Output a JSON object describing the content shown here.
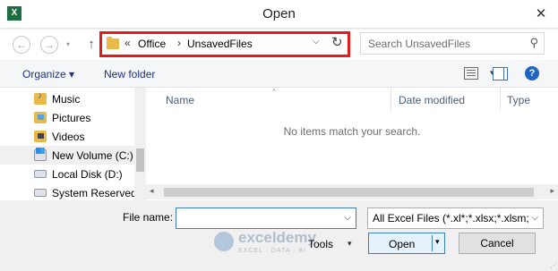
{
  "window": {
    "title": "Open",
    "app_icon": "excel-icon",
    "app_icon_letter": "X",
    "close_symbol": "✕"
  },
  "nav": {
    "back_symbol": "←",
    "forward_symbol": "→",
    "recent_symbol": "▾",
    "up_symbol": "↑"
  },
  "address": {
    "overflow": "«",
    "sep": "›",
    "crumbs": [
      "Office",
      "UnsavedFiles"
    ],
    "dropdown_symbol": "⌵",
    "refresh_symbol": "↻",
    "highlight_color": "#e21b1b"
  },
  "search": {
    "placeholder": "Search UnsavedFiles",
    "icon_symbol": "⚲"
  },
  "toolbar": {
    "organize": "Organize ▾",
    "new_folder": "New folder",
    "view_drop": "▾",
    "help": "?"
  },
  "sidebar": {
    "items": [
      {
        "label": "Music",
        "icon": "music-folder-icon"
      },
      {
        "label": "Pictures",
        "icon": "pictures-folder-icon"
      },
      {
        "label": "Videos",
        "icon": "videos-folder-icon"
      },
      {
        "label": "New Volume (C:)",
        "icon": "windows-drive-icon"
      },
      {
        "label": "Local Disk (D:)",
        "icon": "drive-icon"
      },
      {
        "label": "System Reserved",
        "icon": "drive-icon"
      }
    ]
  },
  "filelist": {
    "columns": [
      "Name",
      "Date modified",
      "Type"
    ],
    "sort_caret": "^",
    "empty_message": "No items match your search.",
    "scroll_left": "◂",
    "scroll_right": "▸"
  },
  "footer": {
    "file_name_label": "File name:",
    "file_name_value": "",
    "file_name_drop": "⌵",
    "file_type": "All Excel Files (*.xl*;*.xlsx;*.xlsm;",
    "file_type_drop": "⌵",
    "tools": "Tools",
    "tools_drop": "▾",
    "open": "Open",
    "open_drop": "▾",
    "cancel": "Cancel"
  },
  "watermark": {
    "name": "exceldemy",
    "tagline": "EXCEL · DATA · BI"
  }
}
